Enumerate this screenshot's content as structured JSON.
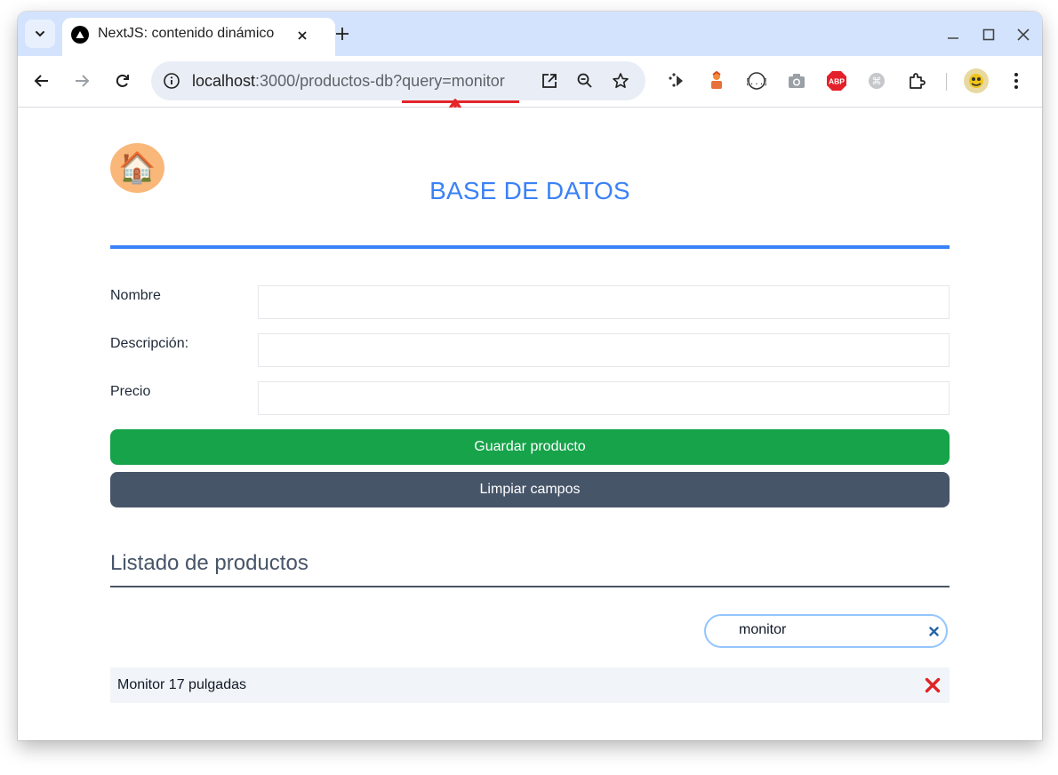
{
  "browser": {
    "tab_title": "NextJS: contenido dinámico",
    "url_host": "localhost",
    "url_path": ":3000/productos-db?query=monitor"
  },
  "page": {
    "heading": "BASE DE DATOS",
    "home_icon": "🏠",
    "form": {
      "name_label": "Nombre",
      "description_label": "Descripción:",
      "price_label": "Precio",
      "name_value": "",
      "description_value": "",
      "price_value": ""
    },
    "buttons": {
      "save_label": "Guardar producto",
      "clear_label": "Limpiar campos"
    },
    "list": {
      "title": "Listado de productos",
      "search_value": "monitor",
      "items": [
        {
          "name": "Monitor 17 pulgadas"
        }
      ]
    }
  },
  "colors": {
    "accent": "#3b82f6",
    "save": "#16a34a",
    "clear": "#475569",
    "annotation": "#e5252a"
  }
}
